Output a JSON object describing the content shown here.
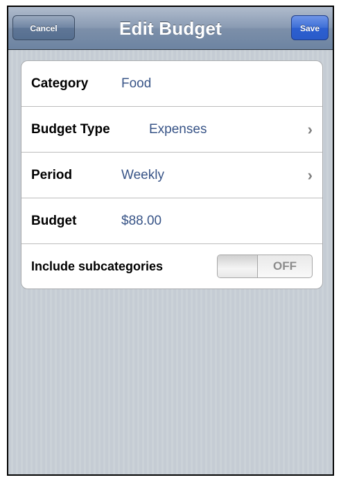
{
  "navbar": {
    "title": "Edit Budget",
    "cancel_label": "Cancel",
    "save_label": "Save"
  },
  "form": {
    "rows": [
      {
        "label": "Category",
        "value": "Food",
        "disclosure": false
      },
      {
        "label": "Budget Type",
        "value": "Expenses",
        "disclosure": true
      },
      {
        "label": "Period",
        "value": "Weekly",
        "disclosure": true
      },
      {
        "label": "Budget",
        "value": "$88.00",
        "disclosure": false
      }
    ],
    "toggle_row": {
      "label": "Include subcategories",
      "state": "OFF"
    }
  },
  "icons": {
    "disclosure": "chevron-right-icon"
  },
  "colors": {
    "navbar": "#7c8fa9",
    "save_button": "#2c5fd0",
    "value_text": "#385487",
    "background": "#c5ccd4"
  }
}
